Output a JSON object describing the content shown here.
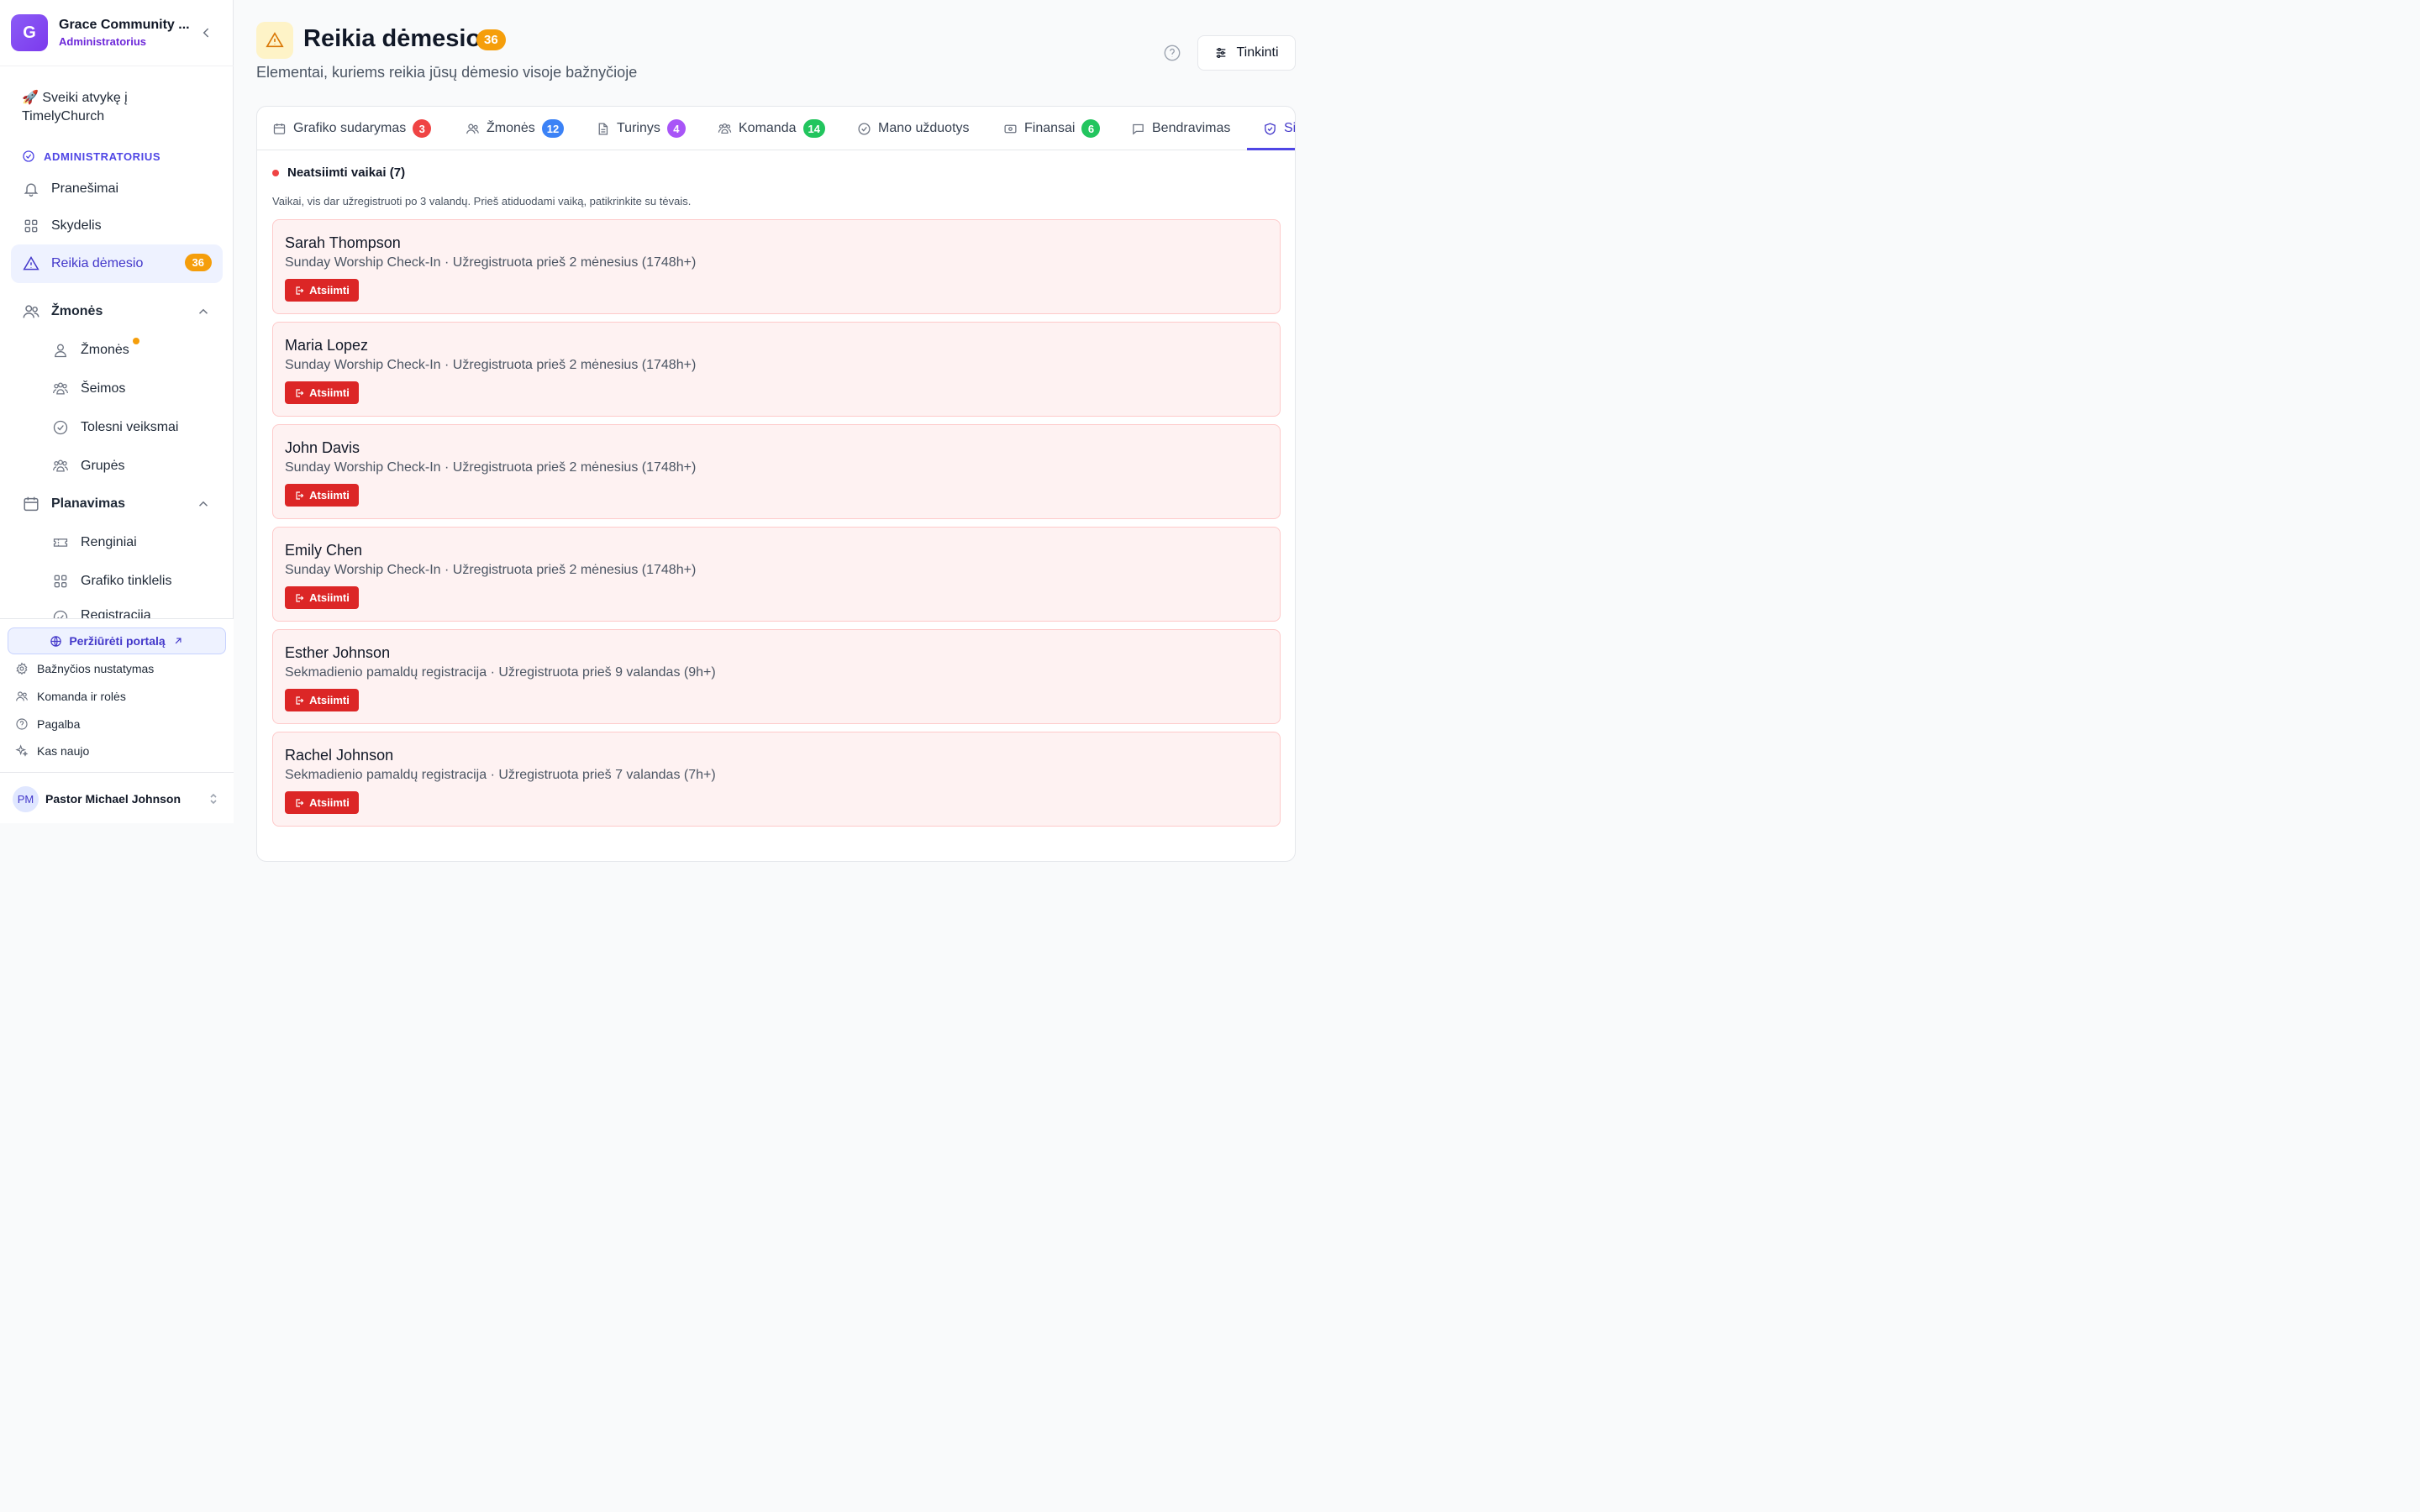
{
  "org": {
    "initial": "G",
    "name": "Grace Community ...",
    "role": "Administratorius"
  },
  "sidebar": {
    "welcome": "🚀 Sveiki atvykę į TimelyChurch",
    "section_label": "ADMINISTRATORIUS",
    "items": [
      {
        "label": "Pranešimai",
        "icon": "bell-icon"
      },
      {
        "label": "Skydelis",
        "icon": "grid-icon"
      },
      {
        "label": "Reikia dėmesio",
        "icon": "warning-icon",
        "badge": "36",
        "active": true
      }
    ],
    "groups": [
      {
        "label": "Žmonės",
        "icon": "users-icon",
        "children": [
          {
            "label": "Žmonės",
            "icon": "user-icon",
            "notification": true
          },
          {
            "label": "Šeimos",
            "icon": "family-icon"
          },
          {
            "label": "Tolesni veiksmai",
            "icon": "check-circle-icon"
          },
          {
            "label": "Grupės",
            "icon": "group-icon"
          }
        ]
      },
      {
        "label": "Planavimas",
        "icon": "calendar-icon",
        "children": [
          {
            "label": "Renginiai",
            "icon": "ticket-icon"
          },
          {
            "label": "Grafiko tinklelis",
            "icon": "grid-icon"
          },
          {
            "label": "Registracija",
            "icon": "check-circle-icon"
          }
        ]
      }
    ],
    "portal_button": "Peržiūrėti portalą",
    "footer_items": [
      {
        "label": "Bažnyčios nustatymas",
        "icon": "gear-icon"
      },
      {
        "label": "Komanda ir rolės",
        "icon": "users-icon"
      },
      {
        "label": "Pagalba",
        "icon": "help-icon"
      },
      {
        "label": "Kas naujo",
        "icon": "sparkles-icon"
      }
    ],
    "user": {
      "initials": "PM",
      "name": "Pastor Michael Johnson"
    }
  },
  "header": {
    "title": "Reikia dėmesio",
    "badge": "36",
    "subtitle": "Elementai, kuriems reikia jūsų dėmesio visoje bažnyčioje",
    "customize_label": "Tinkinti"
  },
  "tabs": [
    {
      "label": "Grafiko sudarymas",
      "badge": "3",
      "badge_color": "#ef4444",
      "icon": "calendar-icon"
    },
    {
      "label": "Žmonės",
      "badge": "12",
      "badge_color": "#3b82f6",
      "icon": "users-icon"
    },
    {
      "label": "Turinys",
      "badge": "4",
      "badge_color": "#a855f7",
      "icon": "document-icon"
    },
    {
      "label": "Komanda",
      "badge": "14",
      "badge_color": "#22c55e",
      "icon": "team-icon"
    },
    {
      "label": "Mano užduotys",
      "icon": "check-circle-icon"
    },
    {
      "label": "Finansai",
      "badge": "6",
      "badge_color": "#22c55e",
      "icon": "money-icon"
    },
    {
      "label": "Bendravimas",
      "icon": "chat-icon"
    },
    {
      "label": "Si",
      "icon": "shield-icon",
      "active": true
    }
  ],
  "section": {
    "title": "Neatsiimti vaikai (7)",
    "description": "Vaikai, vis dar užregistruoti po 3 valandų. Prieš atiduodami vaiką, patikrinkite su tėvais."
  },
  "children": [
    {
      "name": "Sarah Thompson",
      "meta": "Sunday Worship Check-In · Užregistruota prieš 2 mėnesius (1748h+)",
      "action": "Atsiimti"
    },
    {
      "name": "Maria Lopez",
      "meta": "Sunday Worship Check-In · Užregistruota prieš 2 mėnesius (1748h+)",
      "action": "Atsiimti"
    },
    {
      "name": "John Davis",
      "meta": "Sunday Worship Check-In · Užregistruota prieš 2 mėnesius (1748h+)",
      "action": "Atsiimti"
    },
    {
      "name": "Emily Chen",
      "meta": "Sunday Worship Check-In · Užregistruota prieš 2 mėnesius (1748h+)",
      "action": "Atsiimti"
    },
    {
      "name": "Esther Johnson",
      "meta": "Sekmadienio pamaldų registracija · Užregistruota prieš 9 valandas (9h+)",
      "action": "Atsiimti"
    },
    {
      "name": "Rachel Johnson",
      "meta": "Sekmadienio pamaldų registracija · Užregistruota prieš 7 valandas (7h+)",
      "action": "Atsiimti"
    }
  ]
}
